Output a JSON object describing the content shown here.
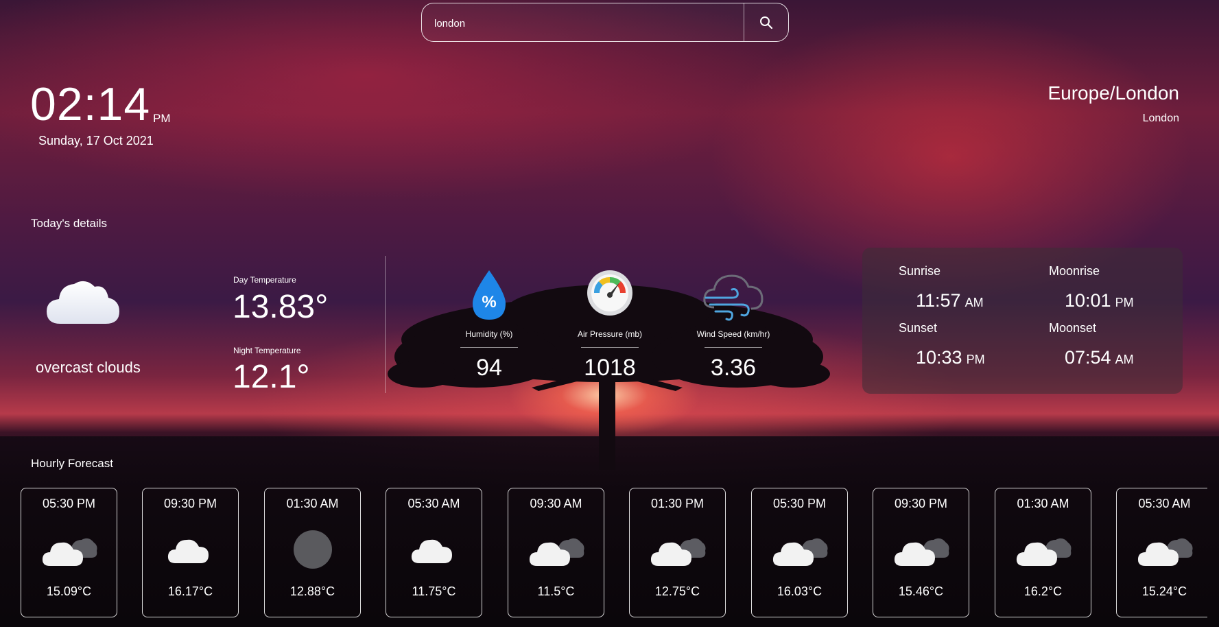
{
  "search": {
    "value": "london"
  },
  "clock": {
    "time": "02:14",
    "ampm": "PM",
    "date": "Sunday, 17 Oct 2021"
  },
  "location": {
    "timezone": "Europe/London",
    "city": "London"
  },
  "today": {
    "heading": "Today's details",
    "condition": "overcast clouds",
    "condition_icon": "cloud-icon",
    "day_temp_label": "Day Temperature",
    "day_temp": "13.83°",
    "night_temp_label": "Night Temperature",
    "night_temp": "12.1°"
  },
  "metrics": [
    {
      "label": "Humidity (%)",
      "value": "94",
      "icon": "humidity-drop-icon"
    },
    {
      "label": "Air Pressure (mb)",
      "value": "1018",
      "icon": "pressure-gauge-icon"
    },
    {
      "label": "Wind Speed (km/hr)",
      "value": "3.36",
      "icon": "wind-cloud-icon"
    }
  ],
  "sun_moon": {
    "sunrise_label": "Sunrise",
    "sunrise_time": "11:57",
    "sunrise_ampm": "AM",
    "sunset_label": "Sunset",
    "sunset_time": "10:33",
    "sunset_ampm": "PM",
    "moonrise_label": "Moonrise",
    "moonrise_time": "10:01",
    "moonrise_ampm": "PM",
    "moonset_label": "Moonset",
    "moonset_time": "07:54",
    "moonset_ampm": "AM"
  },
  "hourly": {
    "heading": "Hourly Forecast",
    "items": [
      {
        "time": "05:30 PM",
        "temp": "15.09°C",
        "icon": "broken-clouds-icon"
      },
      {
        "time": "09:30 PM",
        "temp": "16.17°C",
        "icon": "cloud-icon"
      },
      {
        "time": "01:30 AM",
        "temp": "12.88°C",
        "icon": "dark-cloud-icon"
      },
      {
        "time": "05:30 AM",
        "temp": "11.75°C",
        "icon": "cloud-icon"
      },
      {
        "time": "09:30 AM",
        "temp": "11.5°C",
        "icon": "broken-clouds-icon"
      },
      {
        "time": "01:30 PM",
        "temp": "12.75°C",
        "icon": "broken-clouds-icon"
      },
      {
        "time": "05:30 PM",
        "temp": "16.03°C",
        "icon": "broken-clouds-icon"
      },
      {
        "time": "09:30 PM",
        "temp": "15.46°C",
        "icon": "broken-clouds-icon"
      },
      {
        "time": "01:30 AM",
        "temp": "16.2°C",
        "icon": "broken-clouds-icon"
      },
      {
        "time": "05:30 AM",
        "temp": "15.24°C",
        "icon": "broken-clouds-icon"
      }
    ]
  }
}
